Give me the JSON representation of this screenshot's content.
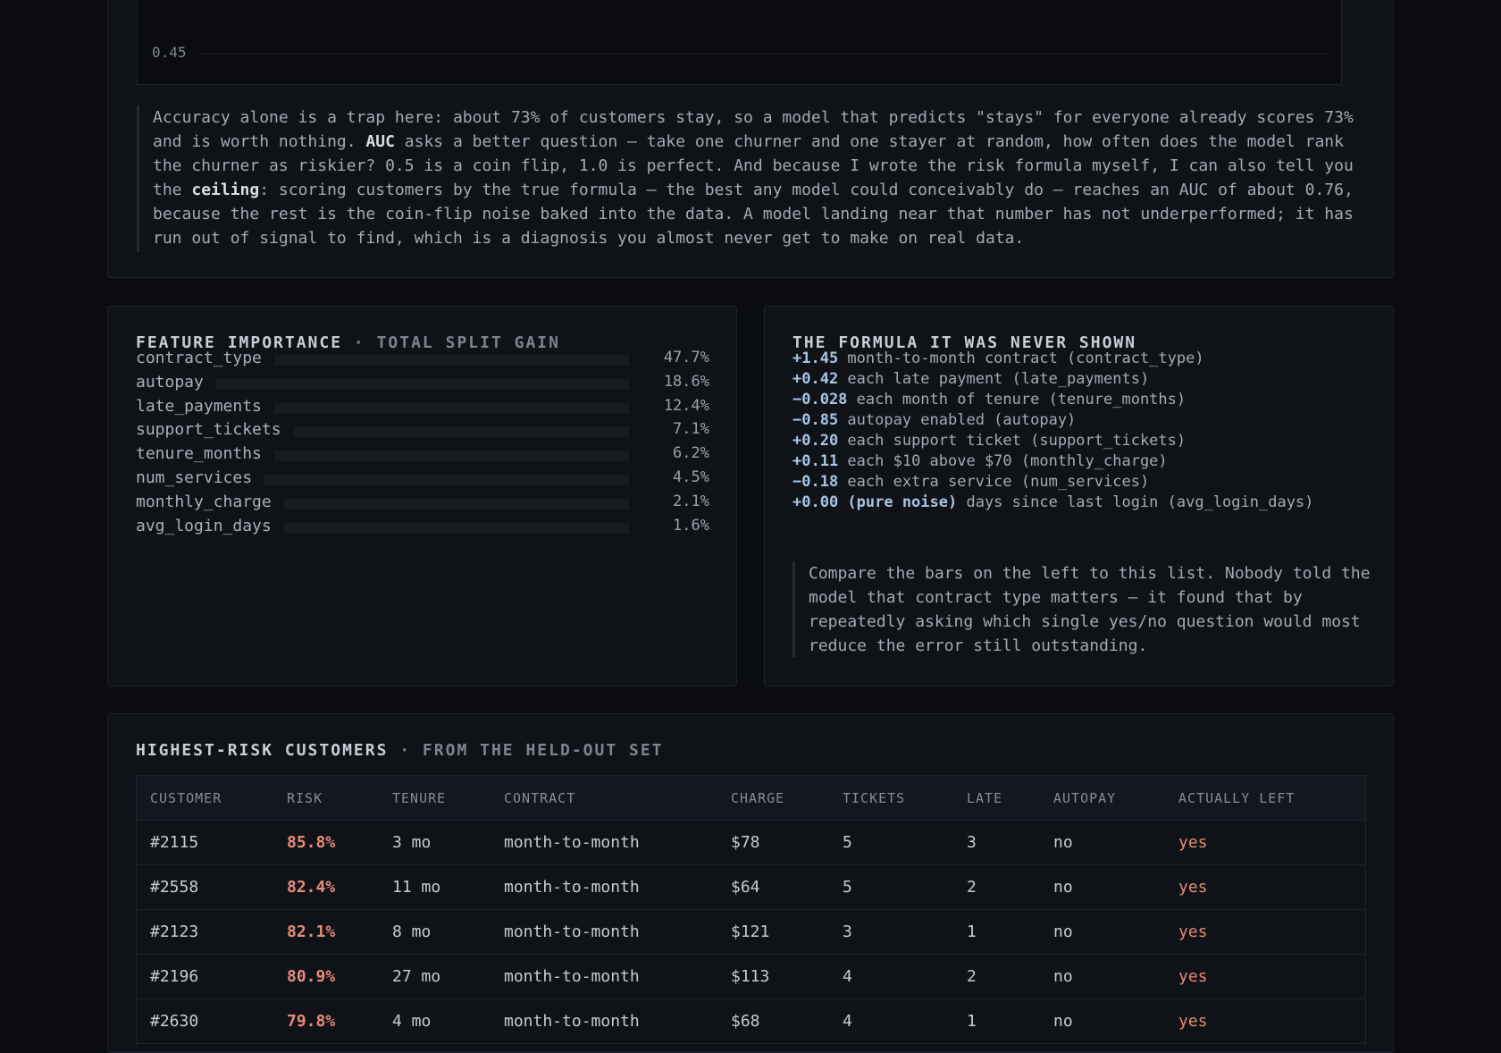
{
  "top_panel": {
    "tick_label": "0.45",
    "note_parts": [
      "Accuracy alone is a trap here: about 73% of customers stay, so a model that predicts \"stays\" for everyone already scores 73% and is worth nothing. ",
      "AUC",
      " asks a better question — take one churner and one stayer at random, how often does the model rank the churner as riskier? 0.5 is a coin flip, 1.0 is perfect. And because I wrote the risk formula myself, I can also tell you the ",
      "ceiling",
      ": scoring customers by the true formula — the best any model could conceivably do — reaches an AUC of about 0.76, because the rest is the coin-flip noise baked into the data. A model landing near that number has not underperformed; it has run out of signal to find, which is a diagnosis you almost never get to make on real data."
    ]
  },
  "feature_importance": {
    "title": "FEATURE IMPORTANCE",
    "subtitle": " · TOTAL SPLIT GAIN",
    "items": [
      {
        "name": "contract_type",
        "pct": "47.7%",
        "value": 47.7
      },
      {
        "name": "autopay",
        "pct": "18.6%",
        "value": 18.6
      },
      {
        "name": "late_payments",
        "pct": "12.4%",
        "value": 12.4
      },
      {
        "name": "support_tickets",
        "pct": "7.1%",
        "value": 7.1
      },
      {
        "name": "tenure_months",
        "pct": "6.2%",
        "value": 6.2
      },
      {
        "name": "num_services",
        "pct": "4.5%",
        "value": 4.5
      },
      {
        "name": "monthly_charge",
        "pct": "2.1%",
        "value": 2.1
      },
      {
        "name": "avg_login_days",
        "pct": "1.6%",
        "value": 1.6
      }
    ]
  },
  "formula": {
    "title": "THE FORMULA IT WAS NEVER SHOWN",
    "rows": [
      {
        "coef": "+1.45",
        "text": " month-to-month contract (contract_type)"
      },
      {
        "coef": "+0.42",
        "text": " each late payment (late_payments)"
      },
      {
        "coef": "−0.028",
        "text": " each month of tenure (tenure_months)"
      },
      {
        "coef": "−0.85",
        "text": " autopay enabled (autopay)"
      },
      {
        "coef": "+0.20",
        "text": " each support ticket (support_tickets)"
      },
      {
        "coef": "+0.11",
        "text": " each $10 above $70 (monthly_charge)"
      },
      {
        "coef": "−0.18",
        "text": " each extra service (num_services)"
      },
      {
        "coef": "+0.00 (pure noise)",
        "text": " days since last login (avg_login_days)"
      }
    ],
    "note": "Compare the bars on the left to this list. Nobody told the model that contract type matters — it found that by repeatedly asking which single yes/no question would most reduce the error still outstanding."
  },
  "risk_table": {
    "title": "HIGHEST-RISK CUSTOMERS",
    "subtitle": " · FROM THE HELD-OUT SET",
    "columns": [
      "CUSTOMER",
      "RISK",
      "TENURE",
      "CONTRACT",
      "CHARGE",
      "TICKETS",
      "LATE",
      "AUTOPAY",
      "ACTUALLY LEFT"
    ],
    "rows": [
      [
        "#2115",
        "85.8%",
        "3 mo",
        "month-to-month",
        "$78",
        "5",
        "3",
        "no",
        "yes"
      ],
      [
        "#2558",
        "82.4%",
        "11 mo",
        "month-to-month",
        "$64",
        "5",
        "2",
        "no",
        "yes"
      ],
      [
        "#2123",
        "82.1%",
        "8 mo",
        "month-to-month",
        "$121",
        "3",
        "1",
        "no",
        "yes"
      ],
      [
        "#2196",
        "80.9%",
        "27 mo",
        "month-to-month",
        "$113",
        "4",
        "2",
        "no",
        "yes"
      ],
      [
        "#2630",
        "79.8%",
        "4 mo",
        "month-to-month",
        "$68",
        "4",
        "1",
        "no",
        "yes"
      ]
    ]
  }
}
